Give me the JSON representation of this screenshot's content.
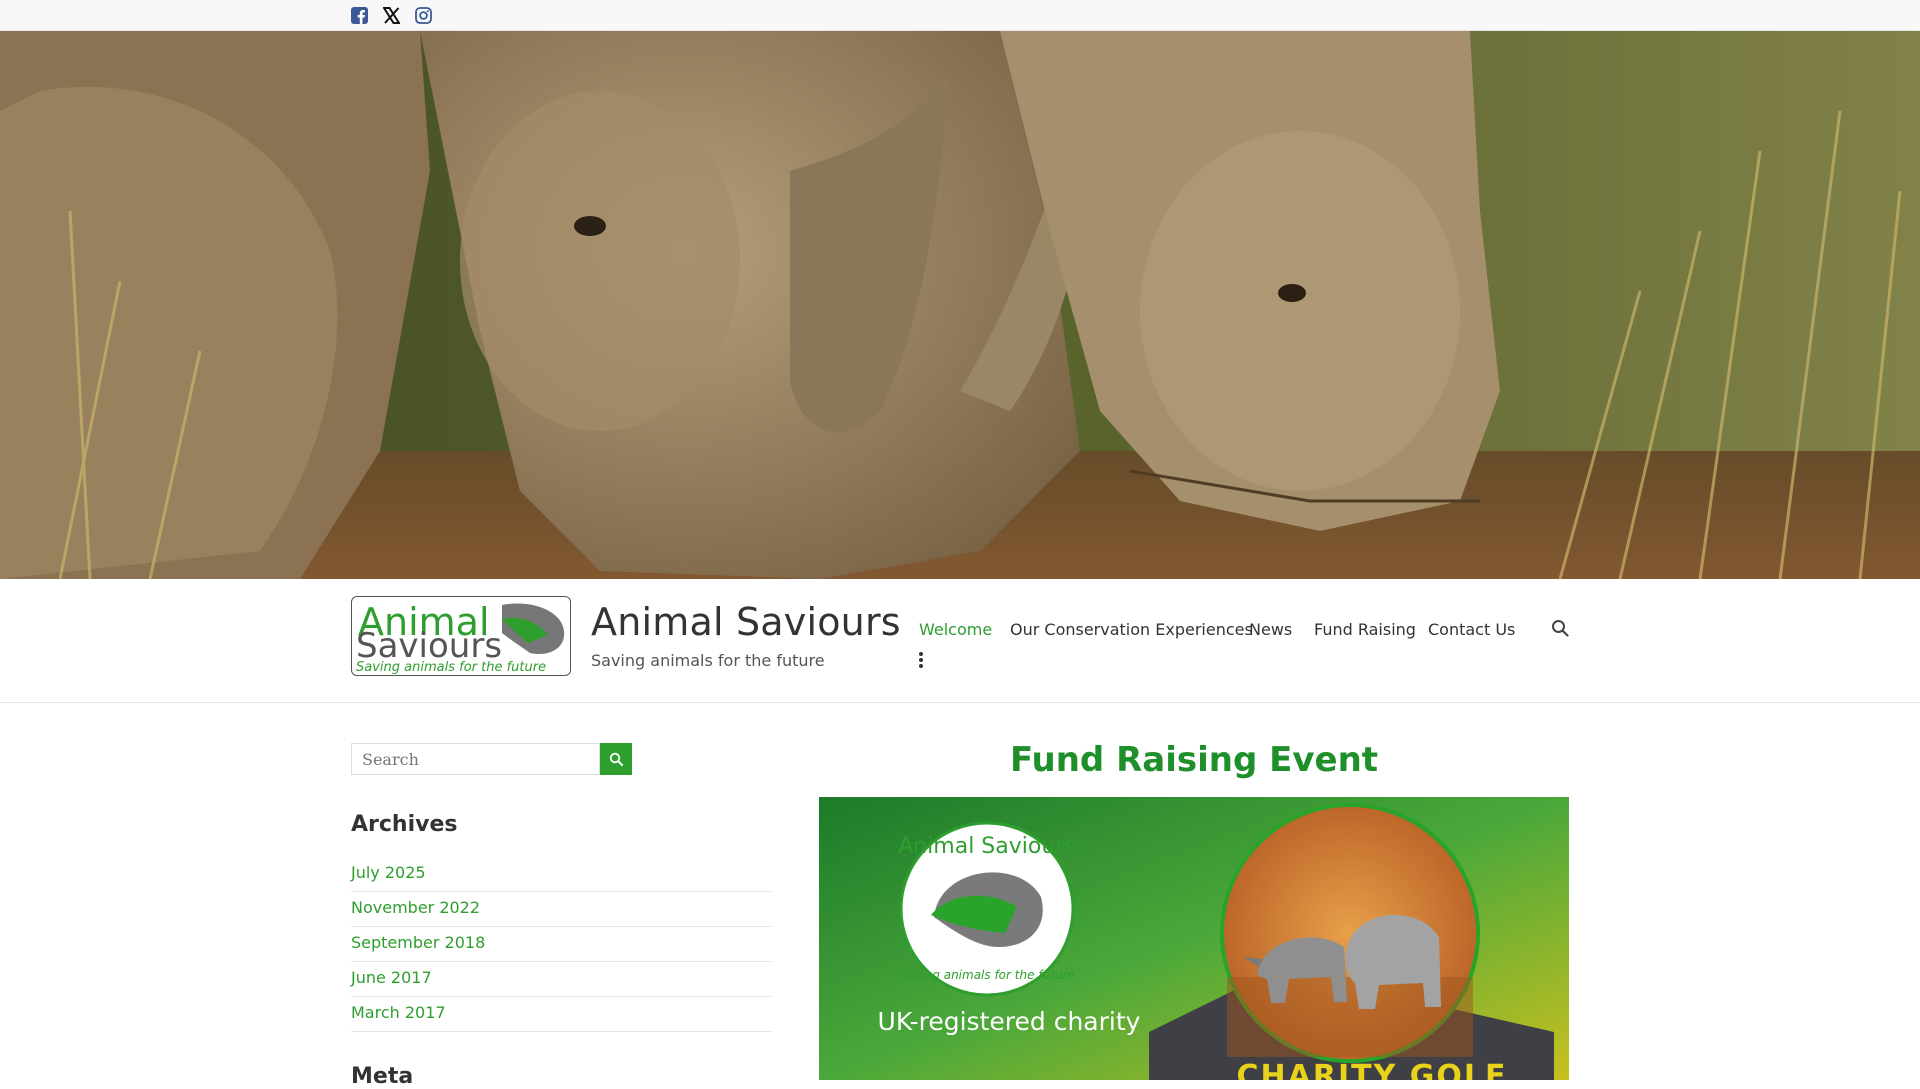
{
  "social": {
    "facebook_icon": "facebook-square-icon",
    "x_icon": "x-twitter-icon",
    "instagram_icon": "instagram-icon"
  },
  "site": {
    "logo_alt": "Animal Saviours - Saving animals for the future",
    "title": "Animal Saviours",
    "tagline": "Saving animals for the future"
  },
  "nav": {
    "items": [
      {
        "label": "Welcome",
        "active": true
      },
      {
        "label": "Our Conservation Experiences",
        "active": false
      },
      {
        "label": "News",
        "active": false
      },
      {
        "label": "Fund Raising",
        "active": false
      },
      {
        "label": "Contact Us",
        "active": false
      }
    ],
    "more_icon": "kebab-menu-icon",
    "search_icon": "search-icon"
  },
  "sidebar": {
    "search_placeholder": "Search",
    "archives_title": "Archives",
    "archives": [
      "July 2025",
      "November 2022",
      "September 2018",
      "June 2017",
      "March 2017"
    ],
    "meta_title": "Meta"
  },
  "post": {
    "title": "Fund Raising Event",
    "image_caption_left": "UK-registered charity",
    "image_caption_right": "CHARITY GOLF"
  },
  "colors": {
    "accent": "#2e9e2e",
    "title_green": "#1f8f2a",
    "topbar_bg": "#f8f8f8"
  }
}
